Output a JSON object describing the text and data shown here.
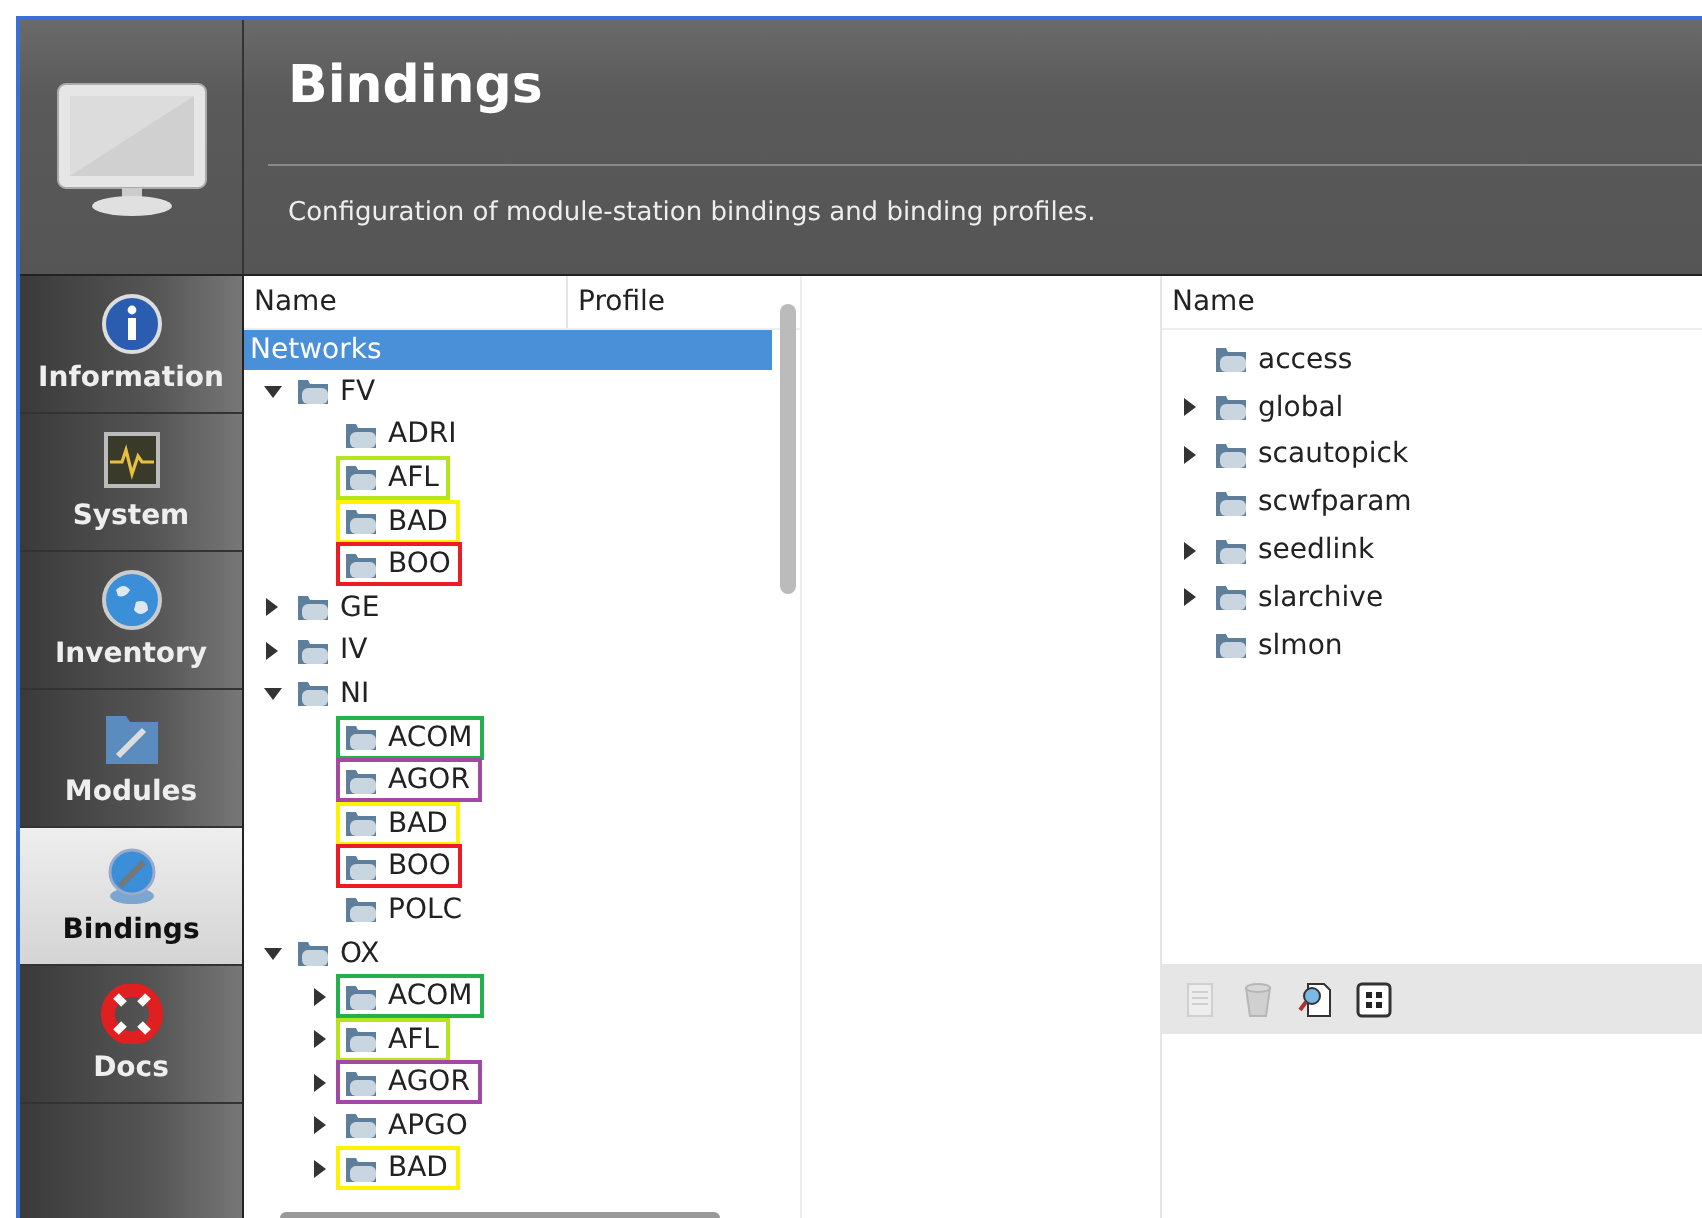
{
  "header": {
    "title": "Bindings",
    "description": "Configuration of module-station bindings and binding profiles."
  },
  "sidebar": {
    "items": [
      {
        "label": "Information",
        "kind": "info",
        "selected": false
      },
      {
        "label": "System",
        "kind": "system",
        "selected": false
      },
      {
        "label": "Inventory",
        "kind": "inventory",
        "selected": false
      },
      {
        "label": "Modules",
        "kind": "modules",
        "selected": false
      },
      {
        "label": "Bindings",
        "kind": "bindings",
        "selected": true
      },
      {
        "label": "Docs",
        "kind": "docs",
        "selected": false
      }
    ]
  },
  "tree": {
    "columns": [
      "Name",
      "Profile"
    ],
    "root": {
      "label": "Networks",
      "selected": true,
      "children": [
        {
          "label": "FV",
          "kind": "group",
          "expanded": true,
          "selected": false,
          "children": [
            {
              "label": "ADRI",
              "kind": "leaf",
              "selected": false
            },
            {
              "label": "AFL",
              "kind": "leaf",
              "selected": false,
              "color": "#b5e61d"
            },
            {
              "label": "BAD",
              "kind": "leaf",
              "selected": false,
              "color": "#fff200"
            },
            {
              "label": "BOO",
              "kind": "leaf",
              "selected": false,
              "color": "#ed1c24"
            }
          ]
        },
        {
          "label": "GE",
          "kind": "group",
          "expanded": false,
          "selected": false
        },
        {
          "label": "IV",
          "kind": "group",
          "expanded": false,
          "selected": false
        },
        {
          "label": "NI",
          "kind": "group",
          "expanded": true,
          "selected": false,
          "children": [
            {
              "label": "ACOM",
              "kind": "leaf",
              "selected": false,
              "color": "#22b14c"
            },
            {
              "label": "AGOR",
              "kind": "leaf",
              "selected": false,
              "color": "#a349a4"
            },
            {
              "label": "BAD",
              "kind": "leaf",
              "selected": false,
              "color": "#fff200"
            },
            {
              "label": "BOO",
              "kind": "leaf",
              "selected": false,
              "color": "#ed1c24"
            },
            {
              "label": "POLC",
              "kind": "leaf",
              "selected": false
            }
          ]
        },
        {
          "label": "OX",
          "kind": "group",
          "expanded": true,
          "selected": false,
          "children": [
            {
              "label": "ACOM",
              "kind": "group",
              "expanded": false,
              "selected": false,
              "color": "#22b14c"
            },
            {
              "label": "AFL",
              "kind": "group",
              "expanded": false,
              "selected": false,
              "color": "#b5e61d"
            },
            {
              "label": "AGOR",
              "kind": "group",
              "expanded": false,
              "selected": false,
              "color": "#a349a4"
            },
            {
              "label": "APGO",
              "kind": "group",
              "expanded": false,
              "selected": false
            },
            {
              "label": "BAD",
              "kind": "group",
              "expanded": false,
              "selected": false,
              "color": "#fff200"
            }
          ]
        }
      ]
    }
  },
  "modules": {
    "column": "Name",
    "items": [
      {
        "label": "access",
        "kind": "leaf"
      },
      {
        "label": "global",
        "kind": "group",
        "expanded": false
      },
      {
        "label": "scautopick",
        "kind": "group",
        "expanded": false
      },
      {
        "label": "scwfparam",
        "kind": "leaf"
      },
      {
        "label": "seedlink",
        "kind": "group",
        "expanded": false
      },
      {
        "label": "slarchive",
        "kind": "group",
        "expanded": false
      },
      {
        "label": "slmon",
        "kind": "leaf"
      }
    ]
  },
  "toolbar": {
    "buttons": [
      {
        "kind": "new",
        "disabled": true
      },
      {
        "kind": "delete",
        "disabled": true
      },
      {
        "kind": "inspect",
        "disabled": false
      },
      {
        "kind": "grid",
        "disabled": false
      }
    ]
  }
}
